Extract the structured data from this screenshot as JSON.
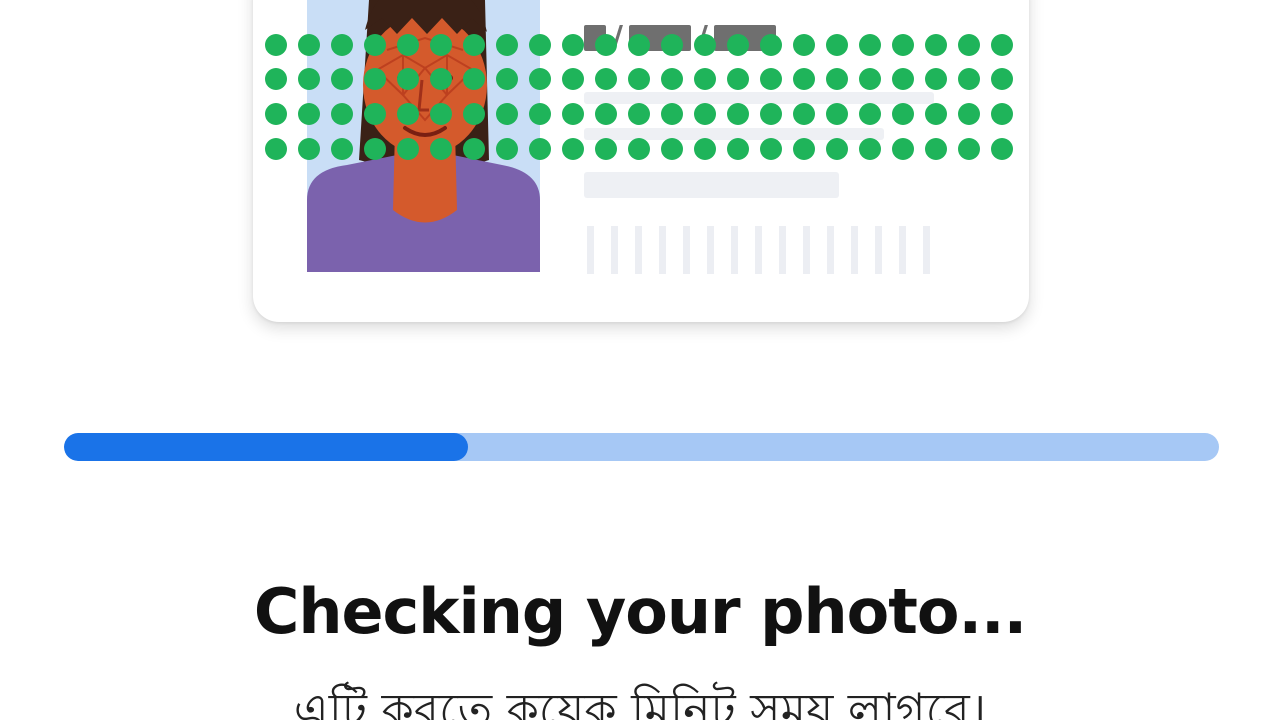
{
  "document_mock": {
    "date_mask": "■ / ■■ / ■■"
  },
  "progress": {
    "fraction": 0.35
  },
  "status": {
    "title": "Checking your photo...",
    "subtitle": "এটি করতে কয়েক মিনিট সময় লাগবে।"
  },
  "colors": {
    "progress_fill": "#1a73e8",
    "progress_track": "#a6c8f5",
    "scan_dot": "#1fb45a",
    "face_mesh": "#d64a2a",
    "shirt": "#7b62ad",
    "hair": "#3a2116",
    "skin": "#d45a2c",
    "portrait_bg": "#c9def6"
  },
  "icons": {
    "scan_overlay": "dot-grid-scan-icon",
    "portrait": "person-portrait-icon",
    "barcode": "barcode-icon"
  }
}
